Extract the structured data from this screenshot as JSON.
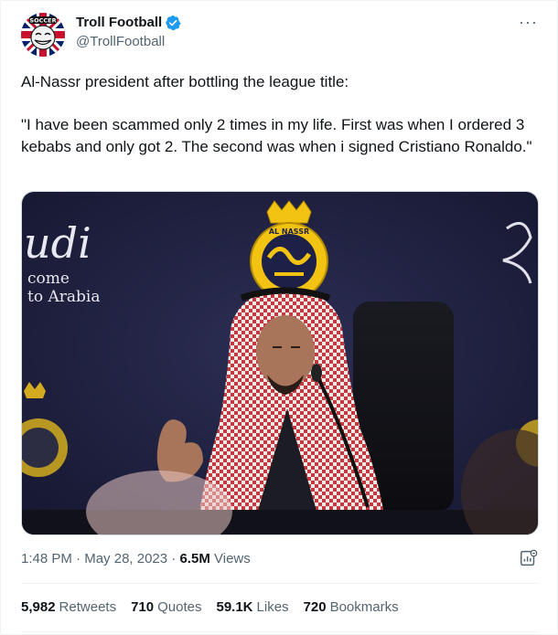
{
  "author": {
    "display_name": "Troll Football",
    "handle": "@TrollFootball",
    "avatar_text": "SOCCER",
    "verified_color": "#1d9bf0"
  },
  "tweet": {
    "lines": [
      "Al-Nassr president after bottling the league title:",
      "\"I have been scammed only 2 times in my life. First was when I ordered 3 kebabs and only got 2. The second was when i signed Cristiano Ronaldo.\""
    ]
  },
  "media": {
    "background_text_1": "udi",
    "background_text_2": "come",
    "background_text_3": "to Arabia",
    "crest_text": "AL NASSR"
  },
  "meta": {
    "time": "1:48 PM",
    "separator": " · ",
    "date": "May 28, 2023",
    "views_count": "6.5M",
    "views_label": "Views"
  },
  "stats": [
    {
      "count": "5,982",
      "label": "Retweets"
    },
    {
      "count": "710",
      "label": "Quotes"
    },
    {
      "count": "59.1K",
      "label": "Likes"
    },
    {
      "count": "720",
      "label": "Bookmarks"
    }
  ],
  "colors": {
    "text": "#0f1419",
    "secondary": "#536471",
    "accent": "#1d9bf0",
    "gold": "#d4a017",
    "navy": "#1a1c3c"
  }
}
